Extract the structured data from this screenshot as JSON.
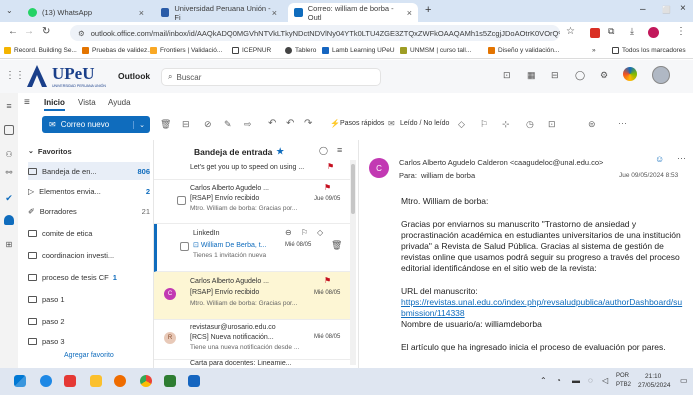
{
  "browser": {
    "tabs": [
      {
        "label": "(13) WhatsApp"
      },
      {
        "label": "Universidad Peruana Unión - Fi"
      },
      {
        "label": "Correo: william de borba - Outl"
      }
    ],
    "new_tab": "+",
    "window_min": "–",
    "window_max": "⬜",
    "address": "outlook.office.com/mail/inbox/id/AAQkADQ0MGVhNTVkLTkyNDctNDVlNy04YTk0LTU4ZGE3ZTQxZWFkOAAQAMh1s5ZcgjJDoAOtrK0VOrQ%...",
    "bookmarks": [
      {
        "label": "Record. Building Se..."
      },
      {
        "label": "Pruebas de validez..."
      },
      {
        "label": "Frontiers | Validació..."
      },
      {
        "label": "ICEPNUR"
      },
      {
        "label": "Tablero"
      },
      {
        "label": "Lamb Learning UPeU"
      },
      {
        "label": "UNMSM | curso tall..."
      },
      {
        "label": "Diseño y validación..."
      },
      {
        "label": "»"
      },
      {
        "label": "Todos los marcadores"
      }
    ]
  },
  "outlook": {
    "logo": "UPeU",
    "logo_sub": "UNIVERSIDAD PERUANA UNIÓN",
    "app_name": "Outlook",
    "search_placeholder": "Buscar",
    "menu": [
      "Inicio",
      "Vista",
      "Ayuda"
    ],
    "new_mail": "Correo nuevo",
    "quick_steps": "Pasos rápidos",
    "read_unread": "Leído / No leído",
    "folders_header": "Favoritos",
    "folders": [
      {
        "label": "Bandeja de en...",
        "count": "806"
      },
      {
        "label": "Elementos envia...",
        "count": "2"
      },
      {
        "label": "Borradores",
        "count": "21"
      },
      {
        "label": "comite de etica",
        "count": ""
      },
      {
        "label": "coordinacion investi...",
        "count": ""
      },
      {
        "label": "proceso de tesis CF",
        "count": "1"
      },
      {
        "label": "paso 1",
        "count": ""
      },
      {
        "label": "paso 2",
        "count": ""
      },
      {
        "label": "paso 3",
        "count": ""
      }
    ],
    "add_favorite": "Agregar favorito",
    "list_title": "Bandeja de entrada",
    "messages": [
      {
        "from": "Let's get you up to speed on using ...",
        "subject": "",
        "preview": "",
        "date": "",
        "avatar": ""
      },
      {
        "from": "Carlos Alberto Agudelo ...",
        "subject": "[RSAP] Envío recibido",
        "preview": "Mtro. William de borba: Gracias por...",
        "date": "Jue 09/05",
        "avatar": ""
      },
      {
        "from": "LinkedIn",
        "subject": "William De Berba, t...",
        "preview": "Tienes 1 invitación nueva",
        "date": "Mié 08/05",
        "avatar": ""
      },
      {
        "from": "Carlos Alberto Agudelo ...",
        "subject": "[RSAP] Envío recibido",
        "preview": "Mtro. William de borba: Gracias por...",
        "date": "Mié 08/05",
        "avatar": "C"
      },
      {
        "from": "revistasur@urosario.edu.co",
        "subject": "[RCS] Nueva notificación...",
        "preview": "Tiene una nueva notificación desde ...",
        "date": "Mié 08/05",
        "avatar": "R"
      },
      {
        "from": "Carta para docentes: Lineamie...",
        "subject": "",
        "preview": "",
        "date": "",
        "avatar": ""
      }
    ],
    "reading": {
      "avatar": "C",
      "from": "Carlos Alberto Agudelo Calderon <caagudeloc@unal.edu.co>",
      "to_label": "Para:",
      "to": "william de borba",
      "date": "Jue 09/05/2024 8:53",
      "greeting": "Mtro. William de borba:",
      "body": "Gracias por enviarnos su manuscrito \"Trastorno de ansiedad y procrastinación académica en estudiantes universitarios de una institución privada\" a Revista de Salud Pública. Gracias al sistema de gestión de revistas online que usamos podrá seguir su progreso a través del proceso editorial identificándose en el sitio web de la revista:",
      "url_label": "URL del manuscrito:",
      "url": "https://revistas.unal.edu.co/index.php/revsaludpublica/authorDashboard/submission/114338",
      "username": "Nombre de usuario/a: williamdeborba",
      "last": "El artículo que ha ingresado inicia el proceso de evaluación por pares."
    }
  },
  "taskbar": {
    "lang": "POR",
    "layout": "PTB2",
    "time": "21:10",
    "date": "27/05/2024"
  }
}
